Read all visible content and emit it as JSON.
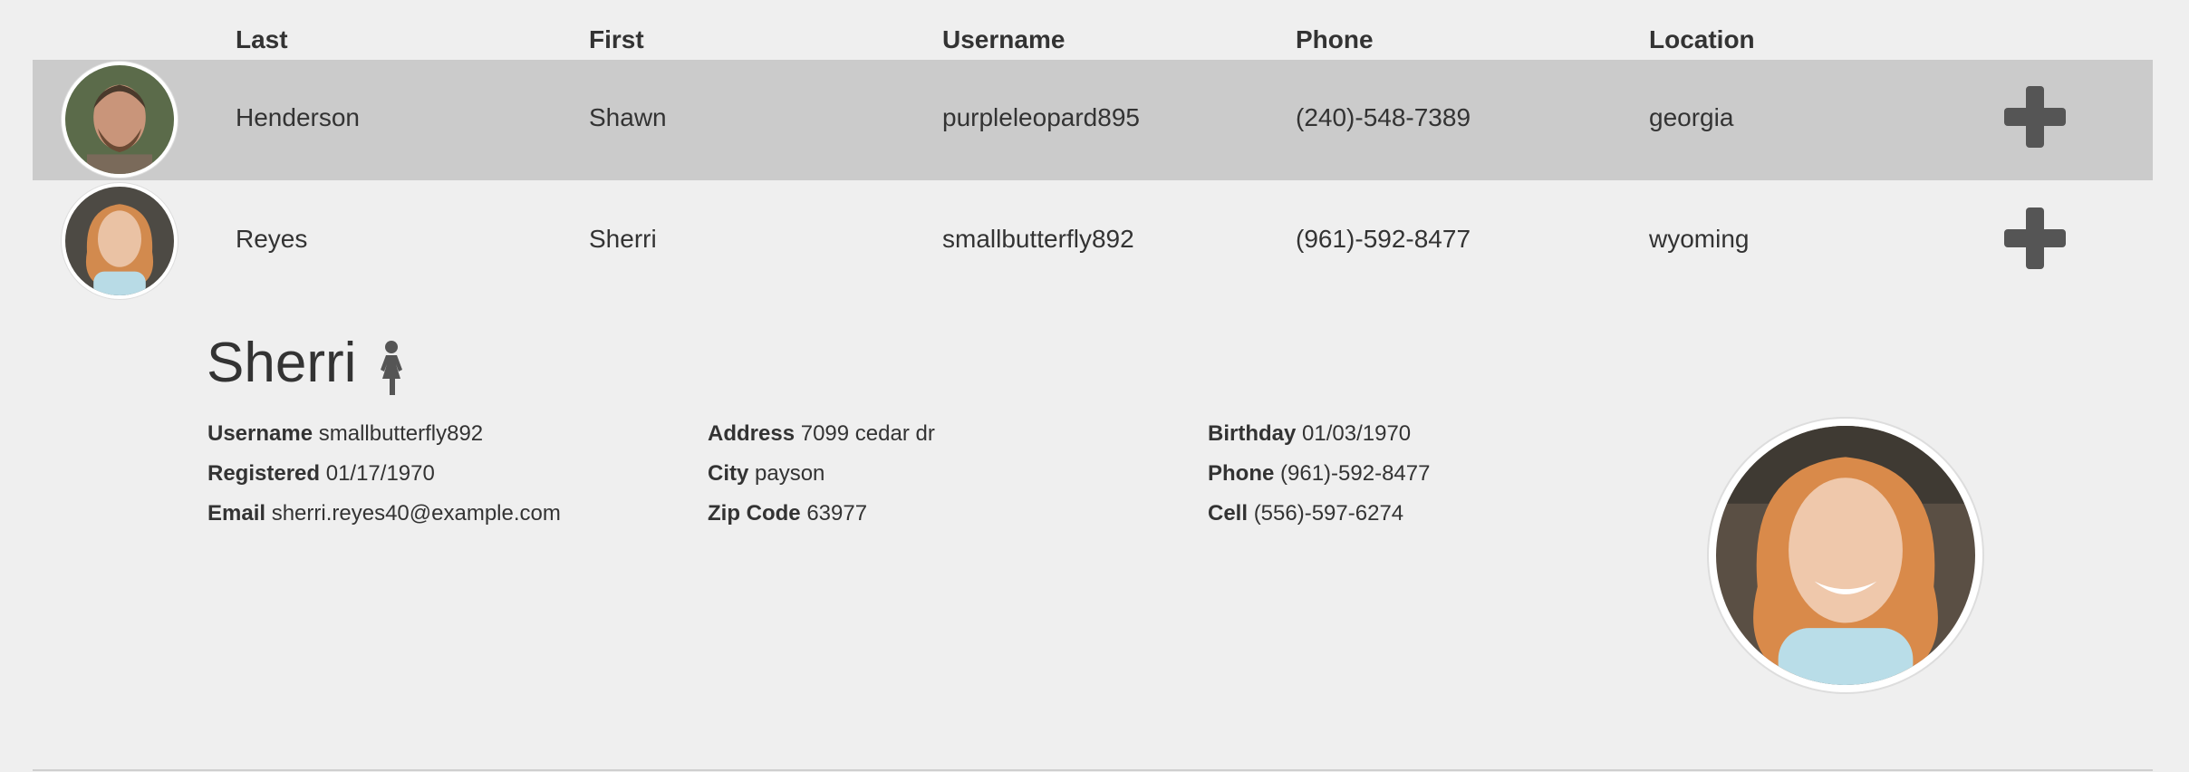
{
  "columns": [
    "Last",
    "First",
    "Username",
    "Phone",
    "Location"
  ],
  "rows": [
    {
      "last": "Henderson",
      "first": "Shawn",
      "username": "purpleleopard895",
      "phone": "(240)-548-7389",
      "location": "georgia"
    },
    {
      "last": "Reyes",
      "first": "Sherri",
      "username": "smallbutterfly892",
      "phone": "(961)-592-8477",
      "location": "wyoming"
    }
  ],
  "detail": {
    "name": "Sherri",
    "username_label": "Username",
    "username": "smallbutterfly892",
    "registered_label": "Registered",
    "registered": "01/17/1970",
    "email_label": "Email",
    "email": "sherri.reyes40@example.com",
    "address_label": "Address",
    "address": "7099 cedar dr",
    "city_label": "City",
    "city": "payson",
    "zip_label": "Zip Code",
    "zip": "63977",
    "birthday_label": "Birthday",
    "birthday": "01/03/1970",
    "phone_label": "Phone",
    "phone": "(961)-592-8477",
    "cell_label": "Cell",
    "cell": "(556)-597-6274"
  },
  "icons": {
    "expand": "plus-icon",
    "gender": "female-icon"
  },
  "colors": {
    "background": "#efefef",
    "highlight_row": "#cbcbcb",
    "text": "#333333",
    "icon": "#555555"
  }
}
